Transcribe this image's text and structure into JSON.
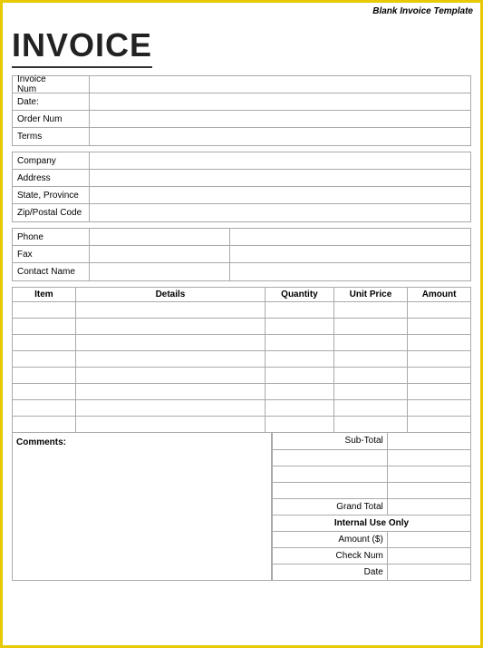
{
  "header": {
    "template_label": "Blank Invoice Template",
    "title": "INVOICE"
  },
  "form1": {
    "rows": [
      {
        "label": "Invoice Num",
        "value": ""
      },
      {
        "label": "Date:",
        "value": ""
      },
      {
        "label": "Order Num",
        "value": ""
      },
      {
        "label": "Terms",
        "value": ""
      }
    ]
  },
  "form2": {
    "rows": [
      {
        "label": "Company",
        "value": ""
      },
      {
        "label": "Address",
        "value": ""
      },
      {
        "label": "State, Province",
        "value": ""
      },
      {
        "label": "Zip/Postal Code",
        "value": ""
      }
    ]
  },
  "form3": {
    "rows": [
      {
        "label": "Phone",
        "value": ""
      },
      {
        "label": "Fax",
        "value": ""
      },
      {
        "label": "Contact Name",
        "value": ""
      }
    ]
  },
  "table": {
    "headers": [
      "Item",
      "Details",
      "Quantity",
      "Unit Price",
      "Amount"
    ],
    "row_count": 8
  },
  "comments": {
    "label": "Comments:"
  },
  "totals": {
    "subtotal_label": "Sub-Total",
    "grand_total_label": "Grand Total",
    "internal_use_label": "Internal Use Only",
    "rows": [
      {
        "label": "Amount ($)",
        "value": ""
      },
      {
        "label": "Check Num",
        "value": ""
      },
      {
        "label": "Date",
        "value": ""
      }
    ]
  }
}
